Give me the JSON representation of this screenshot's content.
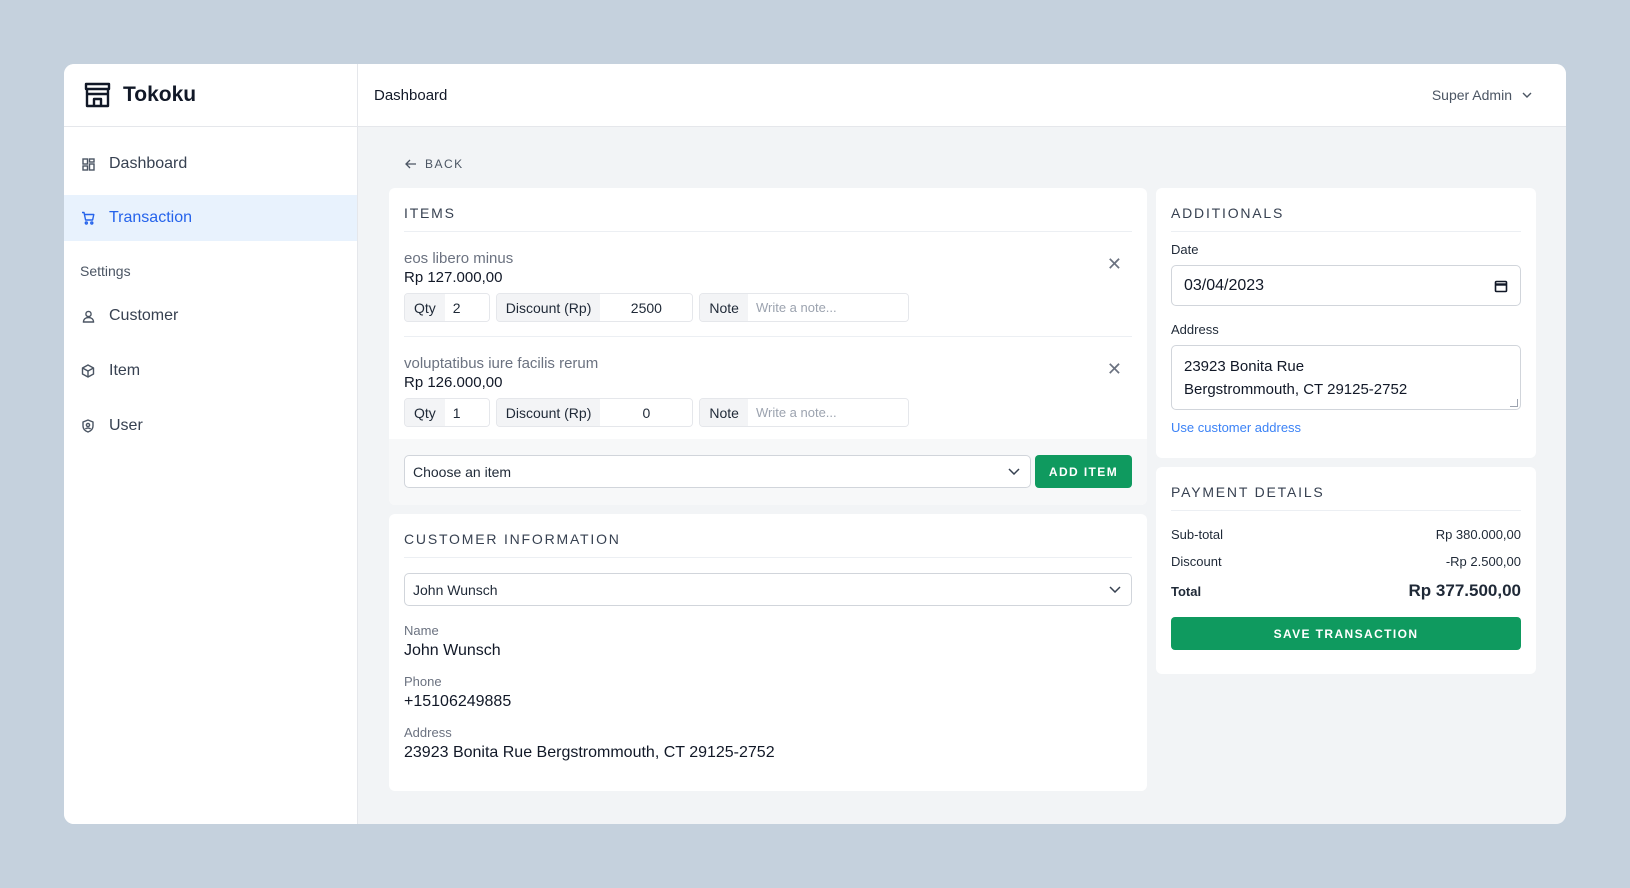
{
  "app": {
    "brand": "Tokoku"
  },
  "sidebar": {
    "items": [
      {
        "label": "Dashboard",
        "icon": "dashboard-icon"
      },
      {
        "label": "Transaction",
        "icon": "cart-icon",
        "active": true
      }
    ],
    "section_label": "Settings",
    "settings_items": [
      {
        "label": "Customer",
        "icon": "user-icon"
      },
      {
        "label": "Item",
        "icon": "box-icon"
      },
      {
        "label": "User",
        "icon": "shield-user-icon"
      }
    ]
  },
  "topbar": {
    "title": "Dashboard",
    "user": "Super Admin"
  },
  "back_label": "BACK",
  "items_card": {
    "title": "ITEMS",
    "rows": [
      {
        "name": "eos libero minus",
        "price": "Rp 127.000,00",
        "qty_label": "Qty",
        "qty": "2",
        "discount_label": "Discount (Rp)",
        "discount": "2500",
        "note_label": "Note",
        "note_placeholder": "Write a note..."
      },
      {
        "name": "voluptatibus iure facilis rerum",
        "price": "Rp 126.000,00",
        "qty_label": "Qty",
        "qty": "1",
        "discount_label": "Discount (Rp)",
        "discount": "0",
        "note_label": "Note",
        "note_placeholder": "Write a note..."
      }
    ],
    "choose_placeholder": "Choose an item",
    "add_button": "ADD ITEM"
  },
  "customer_card": {
    "title": "CUSTOMER INFORMATION",
    "selected": "John Wunsch",
    "name_label": "Name",
    "name": "John Wunsch",
    "phone_label": "Phone",
    "phone": "+15106249885",
    "address_label": "Address",
    "address": "23923 Bonita Rue Bergstrommouth, CT 29125-2752"
  },
  "additionals": {
    "title": "ADDITIONALS",
    "date_label": "Date",
    "date": "03/04/2023",
    "address_label": "Address",
    "address_line1": "23923 Bonita Rue",
    "address_line2": "Bergstrommouth, CT 29125-2752",
    "use_customer_address": "Use customer address"
  },
  "payment": {
    "title": "PAYMENT DETAILS",
    "subtotal_label": "Sub-total",
    "subtotal": "Rp 380.000,00",
    "discount_label": "Discount",
    "discount": "-Rp 2.500,00",
    "total_label": "Total",
    "total": "Rp 377.500,00",
    "save_button": "SAVE TRANSACTION"
  },
  "colors": {
    "accent_green": "#0f9a5f",
    "active_blue": "#2563eb",
    "link_blue": "#3b82f6",
    "background": "#c5d1dd"
  }
}
